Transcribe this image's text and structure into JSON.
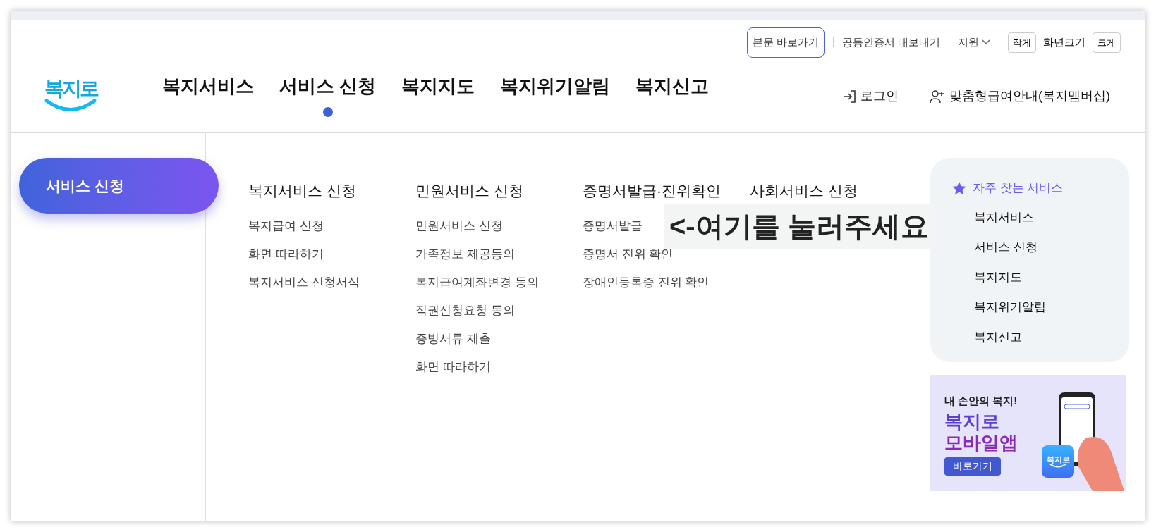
{
  "logo": {
    "text": "복지로"
  },
  "utility_links": [
    {
      "label": "본문 바로가기",
      "kind": "outlined"
    },
    {
      "label": "공동인증서 내보내기",
      "kind": "plain"
    },
    {
      "label": "지원",
      "kind": "dropdown"
    }
  ],
  "font_size": {
    "smaller": "작게",
    "label": "화면크기",
    "larger": "크게"
  },
  "nav": [
    {
      "label": "복지서비스",
      "selected": false
    },
    {
      "label": "서비스 신청",
      "selected": true
    },
    {
      "label": "복지지도",
      "selected": false
    },
    {
      "label": "복지위기알림",
      "selected": false
    },
    {
      "label": "복지신고",
      "selected": false
    }
  ],
  "account": [
    {
      "label": "로그인",
      "kind": "login"
    },
    {
      "label": "맞춤형급여안내(복지멤버십)",
      "kind": "member"
    }
  ],
  "side_tab": {
    "label": "서비스 신청"
  },
  "menu_columns": [
    {
      "title": "복지서비스 신청",
      "items": [
        "복지급여 신청",
        "화면 따라하기",
        "복지서비스 신청서식"
      ]
    },
    {
      "title": "민원서비스 신청",
      "items": [
        "민원서비스 신청",
        "가족정보 제공동의",
        "복지급여계좌변경 동의",
        "직권신청요청 동의",
        "증빙서류 제출",
        "화면 따라하기"
      ]
    },
    {
      "title": "증명서발급·진위확인",
      "items": [
        "증명서발급",
        "증명서 진위 확인",
        "장애인등록증 진위 확인"
      ]
    },
    {
      "title": "사회서비스 신청"
    }
  ],
  "overlay_note": "<-여기를 눌러주세요",
  "favorites": {
    "title": "자주 찾는 서비스",
    "items": [
      "복지서비스",
      "서비스 신청",
      "복지지도",
      "복지위기알림",
      "복지신고"
    ]
  },
  "banner": {
    "tagline": "내 손안의 복지!",
    "headline_1": "복지로",
    "headline_2": "모바일앱",
    "button": "바로가기",
    "app_icon_text": "복지로"
  }
}
